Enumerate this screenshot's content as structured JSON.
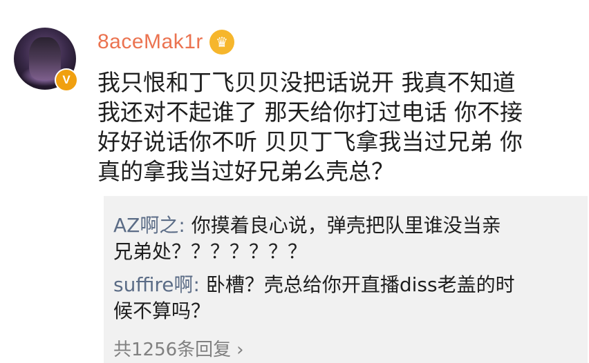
{
  "post": {
    "username": "8aceMak1r",
    "crown_icon": "crown-badge-icon",
    "verified_badge": "V",
    "text_lines": [
      "我只恨和丁飞贝贝没把话说开 我真不知道",
      "我还对不起谁了 那天给你打过电话 你不接",
      "好好说话你不听 贝贝丁飞拿我当过兄弟 你",
      "真的拿我当过好兄弟么壳总？"
    ]
  },
  "replies": [
    {
      "name": "AZ啊之",
      "sep": ": ",
      "lines": [
        "你摸着良心说，弹壳把队里谁没当亲",
        "兄弟处？？？？？？？"
      ]
    },
    {
      "name": "suffire啊",
      "sep": ": ",
      "lines": [
        "卧槽？壳总给你开直播diss老盖的时",
        "候不算吗？"
      ]
    }
  ],
  "more_replies": {
    "label": "共1256条回复",
    "chevron": "›"
  },
  "colors": {
    "username": "#eb7350",
    "reply_name": "#5b6c86",
    "reply_bg": "#f1f1f1",
    "verified": "#f0a010",
    "crown": "#f6b62c"
  }
}
